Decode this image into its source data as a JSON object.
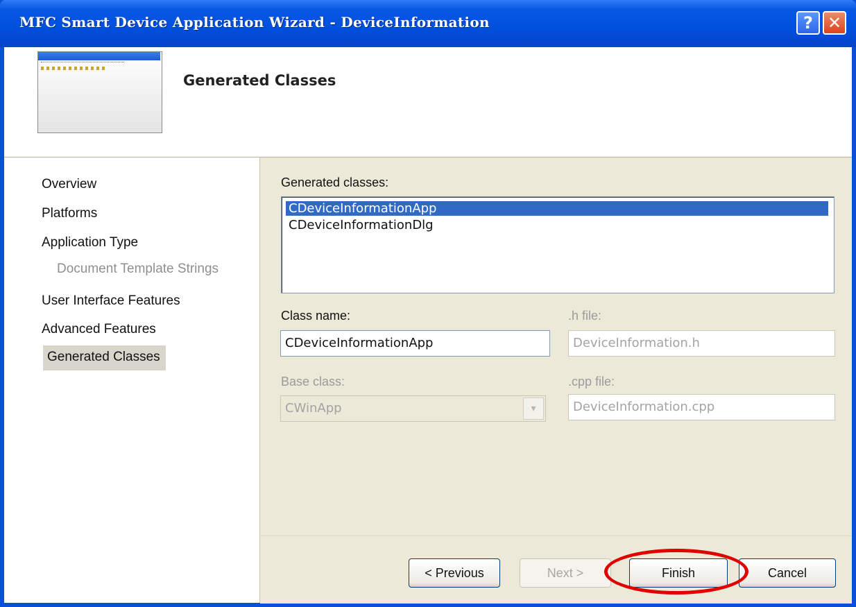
{
  "window": {
    "title": "MFC Smart Device Application Wizard - DeviceInformation"
  },
  "titlebar_buttons": {
    "help": "?",
    "close": "✕"
  },
  "header": {
    "title": "Generated Classes"
  },
  "sidebar": {
    "items": [
      {
        "label": "Overview",
        "state": "normal"
      },
      {
        "label": "Platforms",
        "state": "normal"
      },
      {
        "label": "Application Type",
        "state": "normal"
      },
      {
        "label": "Document Template Strings",
        "state": "disabled"
      },
      {
        "label": "User Interface Features",
        "state": "normal"
      },
      {
        "label": "Advanced Features",
        "state": "normal"
      },
      {
        "label": "Generated Classes",
        "state": "selected"
      }
    ]
  },
  "content": {
    "generated_classes_label": "Generated classes:",
    "classes": [
      "CDeviceInformationApp",
      "CDeviceInformationDlg"
    ],
    "selected_class": "CDeviceInformationApp",
    "class_name_label": "Class name:",
    "class_name_value": "CDeviceInformationApp",
    "h_file_label": ".h file:",
    "h_file_value": "DeviceInformation.h",
    "base_class_label": "Base class:",
    "base_class_value": "CWinApp",
    "cpp_file_label": ".cpp file:",
    "cpp_file_value": "DeviceInformation.cpp"
  },
  "buttons": {
    "previous": "< Previous",
    "next": "Next >",
    "finish": "Finish",
    "cancel": "Cancel"
  },
  "colors": {
    "titlebar": "#0050de",
    "selection": "#316ac5",
    "highlight_circle": "#e00000"
  }
}
